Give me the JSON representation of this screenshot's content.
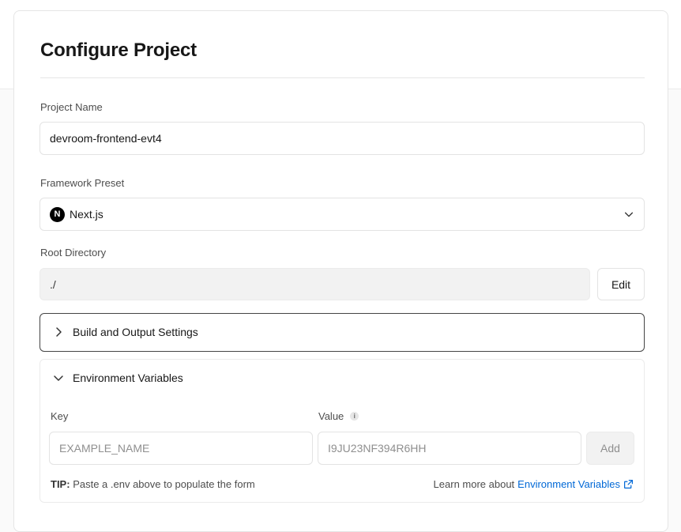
{
  "page": {
    "title": "Configure Project"
  },
  "project_name": {
    "label": "Project Name",
    "value": "devroom-frontend-evt4"
  },
  "framework": {
    "label": "Framework Preset",
    "logo_glyph": "N",
    "value": "Next.js",
    "icon": "chevron-down-icon"
  },
  "root_directory": {
    "label": "Root Directory",
    "value": "./",
    "edit_label": "Edit"
  },
  "build_settings": {
    "label": "Build and Output Settings",
    "expanded": false
  },
  "env_vars": {
    "label": "Environment Variables",
    "expanded": true,
    "key_label": "Key",
    "value_label": "Value",
    "info_glyph": "i",
    "key_placeholder": "EXAMPLE_NAME",
    "value_placeholder": "I9JU23NF394R6HH",
    "add_label": "Add",
    "tip_prefix": "TIP:",
    "tip_text": "Paste a .env above to populate the form",
    "learn_prefix": "Learn more about",
    "learn_link": "Environment Variables"
  },
  "colors": {
    "link": "#0068d6",
    "border": "#e3e3e3",
    "active_border": "#444444"
  }
}
